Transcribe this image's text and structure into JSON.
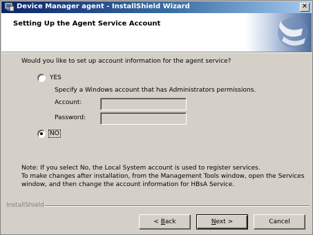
{
  "window": {
    "title": "Device Manager agent - InstallShield Wizard"
  },
  "header": {
    "title": "Setting Up the Agent Service Account"
  },
  "form": {
    "question": "Would you like to set up account information for the agent service?",
    "options": [
      {
        "label": "YES",
        "selected": false
      },
      {
        "label": "NO",
        "selected": true
      }
    ],
    "hint": "Specify a Windows account that has Administrators permissions.",
    "account_label": "Account:",
    "account_value": "",
    "password_label": "Password:",
    "password_value": ""
  },
  "note": {
    "line1": "Note: If you select No, the Local System account is used to register services.",
    "line2": "To make changes after installation, from the Management Tools window, open the Services window, and then change the account information for HBsA Service."
  },
  "footer": {
    "brand": "InstallShield",
    "back_prefix": "< ",
    "back_mnemonic": "B",
    "back_rest": "ack",
    "next_mnemonic": "N",
    "next_rest": "ext >",
    "cancel_label": "Cancel"
  },
  "colors": {
    "titlebar_start": "#0a246a",
    "titlebar_end": "#a6caf0",
    "dialog_face": "#d4d0c8"
  }
}
